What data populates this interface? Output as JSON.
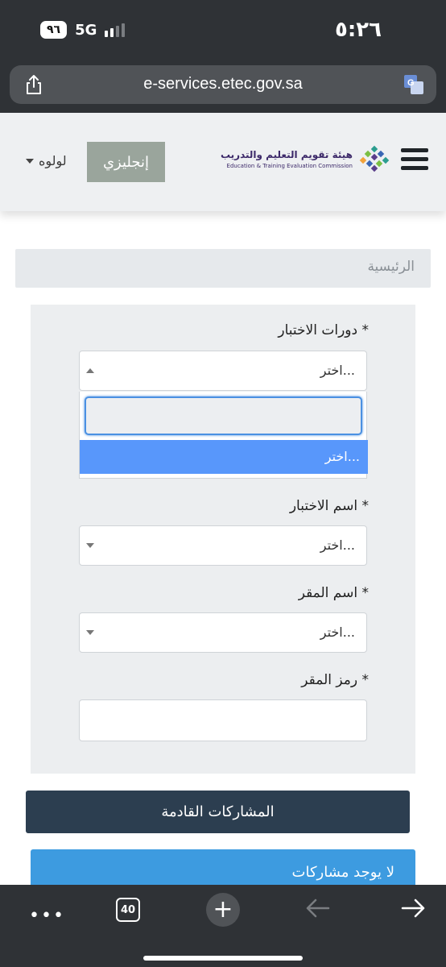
{
  "status_bar": {
    "time": "٥:٢٦",
    "battery": "٩٦",
    "network": "5G"
  },
  "browser": {
    "url": "e-services.etec.gov.sa",
    "open_tabs": "40"
  },
  "header": {
    "logo_ar": "هيئة تقويم التعليم والتدريب",
    "logo_en": "Education & Training Evaluation Commission",
    "language_button": "إنجليزي",
    "user_name": "لولوه"
  },
  "breadcrumb": {
    "home": "الرئيسية"
  },
  "form": {
    "test_rounds": {
      "label": "دورات الاختبار *",
      "value": "اختر...",
      "options": [
        "اختر..."
      ]
    },
    "test_name": {
      "label": "اسم الاختبار *",
      "value": "اختر..."
    },
    "center_name": {
      "label": "اسم المقر *",
      "value": "اختر..."
    },
    "center_code": {
      "label": "رمز المقر *",
      "value": ""
    }
  },
  "actions": {
    "upcoming_label": "المشاركات القادمة",
    "no_participations": "لا يوجد مشاركات"
  },
  "colors": {
    "header_bg": "#eef0f2",
    "primary_dark": "#2c3e50",
    "info_blue": "#3d9be0",
    "option_highlight": "#5897fb"
  }
}
